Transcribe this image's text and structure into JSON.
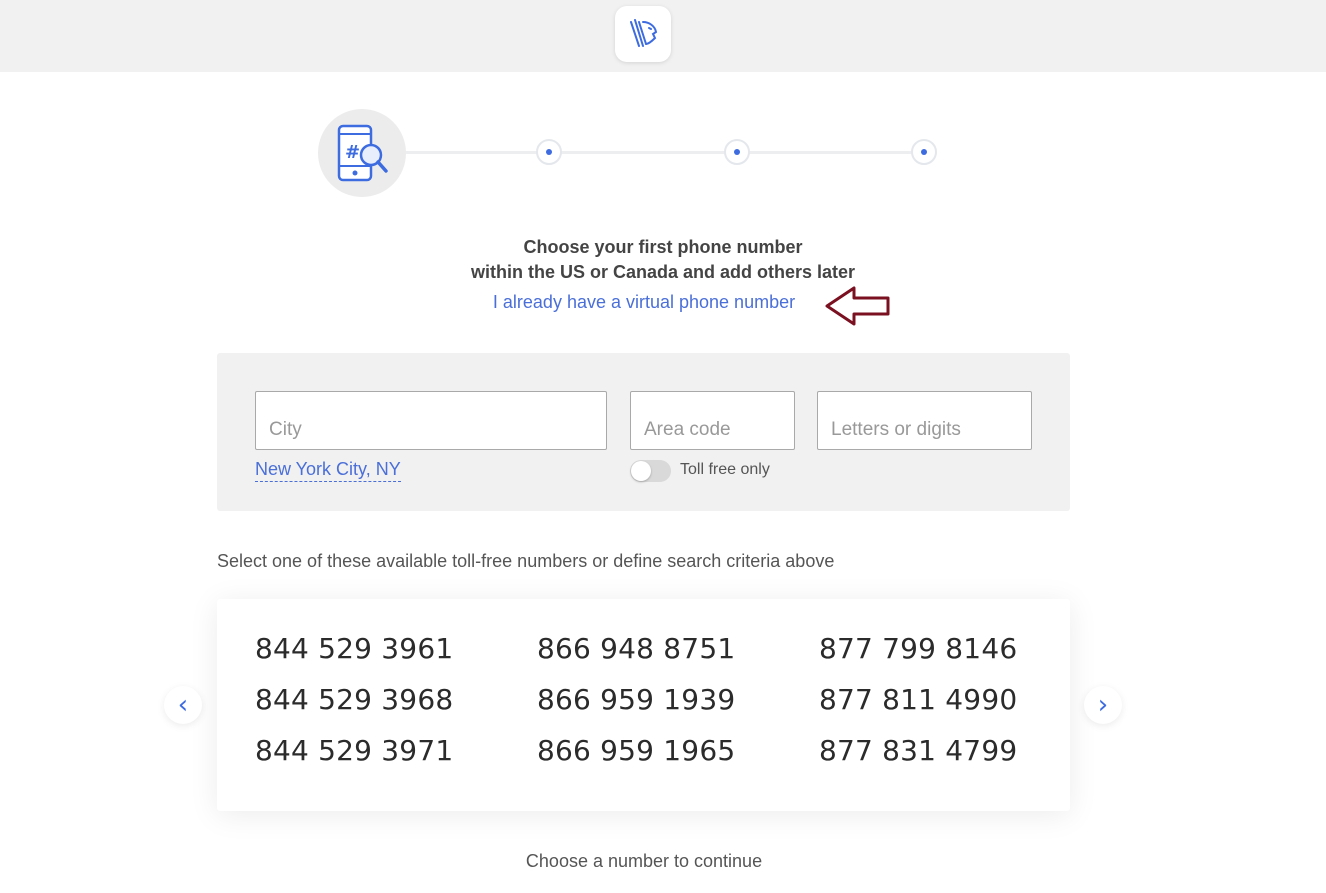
{
  "header": {
    "logo_icon": "lion-logo-icon"
  },
  "stepper": {
    "current_icon": "phone-search-icon",
    "steps": 4,
    "accent": "#3d6be0"
  },
  "title": {
    "line1": "Choose your first phone number",
    "line2": "within the US or Canada and add others later"
  },
  "virtual_link": "I already have a virtual phone number",
  "annotation": {
    "icon": "arrow-left-outline-icon",
    "color": "#7a1020"
  },
  "search": {
    "city_placeholder": "City",
    "area_placeholder": "Area code",
    "letters_placeholder": "Letters or digits",
    "city_suggestion": "New York City, NY",
    "toll_free_label": "Toll free only"
  },
  "hint": "Select one of these available toll-free numbers or define search criteria above",
  "numbers": [
    [
      "844 529 3961",
      "844 529 3968",
      "844 529 3971"
    ],
    [
      "866 948 8751",
      "866 959 1939",
      "866 959 1965"
    ],
    [
      "877 799 8146",
      "877 811 4990",
      "877 831 4799"
    ]
  ],
  "nav": {
    "prev": "‹",
    "next": "›"
  },
  "footer": "Choose a number to continue"
}
